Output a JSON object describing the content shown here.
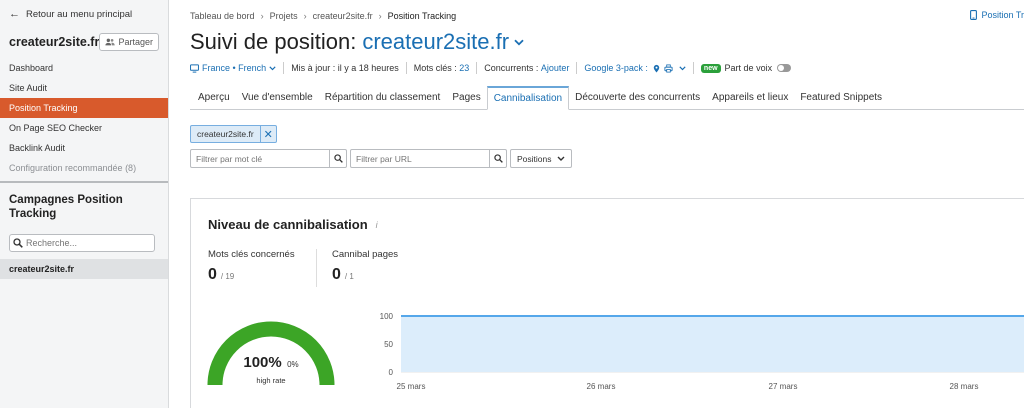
{
  "sidebar": {
    "back_label": "Retour au menu principal",
    "project_name": "createur2site.fr",
    "share_label": "Partager",
    "nav": [
      {
        "label": "Dashboard",
        "active": false
      },
      {
        "label": "Site Audit",
        "active": false
      },
      {
        "label": "Position Tracking",
        "active": true
      },
      {
        "label": "On Page SEO Checker",
        "active": false
      },
      {
        "label": "Backlink Audit",
        "active": false
      },
      {
        "label": "Configuration recommandée (8)",
        "active": false,
        "muted": true
      }
    ],
    "campaigns_title": "Campagnes Position Tracking",
    "search_placeholder": "Recherche...",
    "campaign": "createur2site.fr"
  },
  "header": {
    "breadcrumb": [
      "Tableau de bord",
      "Projets",
      "createur2site.fr",
      "Position Tracking"
    ],
    "top_right_link": "Position Tr",
    "title_prefix": "Suivi de position:",
    "title_domain": "createur2site.fr"
  },
  "toolbar": {
    "location": "France • French",
    "updated": "Mis à jour : il y a 18 heures",
    "keywords_label": "Mots clés :",
    "keywords_value": "23",
    "competitors_label": "Concurrents :",
    "competitors_value": "Ajouter",
    "google_pack": "Google 3-pack :",
    "new_badge": "new",
    "share_of_voice": "Part de voix"
  },
  "tabs": [
    {
      "label": "Aperçu",
      "active": false
    },
    {
      "label": "Vue d'ensemble",
      "active": false
    },
    {
      "label": "Répartition du classement",
      "active": false
    },
    {
      "label": "Pages",
      "active": false
    },
    {
      "label": "Cannibalisation",
      "active": true
    },
    {
      "label": "Découverte des concurrents",
      "active": false
    },
    {
      "label": "Appareils et lieux",
      "active": false
    },
    {
      "label": "Featured Snippets",
      "active": false
    }
  ],
  "filters": {
    "chip": "createur2site.fr",
    "keyword_placeholder": "Filtrer par mot clé",
    "url_placeholder": "Filtrer par URL",
    "positions_label": "Positions"
  },
  "card": {
    "title": "Niveau de cannibalisation",
    "info": "i",
    "metric1_label": "Mots clés concernés",
    "metric1_value": "0",
    "metric1_total": "/ 19",
    "metric2_label": "Cannibal pages",
    "metric2_value": "0",
    "metric2_total": "/ 1",
    "gauge_pct": "100%",
    "gauge_sub": "0%",
    "gauge_label": "high rate",
    "gauge_fraction": 1.0
  },
  "colors": {
    "accent": "#1a6fb3",
    "active_nav": "#d85a2c",
    "gauge": "#3ca526",
    "chart_line": "#55a7ea",
    "chart_fill": "#dcedfb"
  },
  "chart_data": {
    "type": "area",
    "x": [
      "25 mars",
      "26 mars",
      "27 mars",
      "28 mars"
    ],
    "y": [
      100,
      100,
      100,
      100
    ],
    "yticks": [
      100,
      50,
      0
    ],
    "ylim": [
      0,
      100
    ],
    "grid": true
  }
}
